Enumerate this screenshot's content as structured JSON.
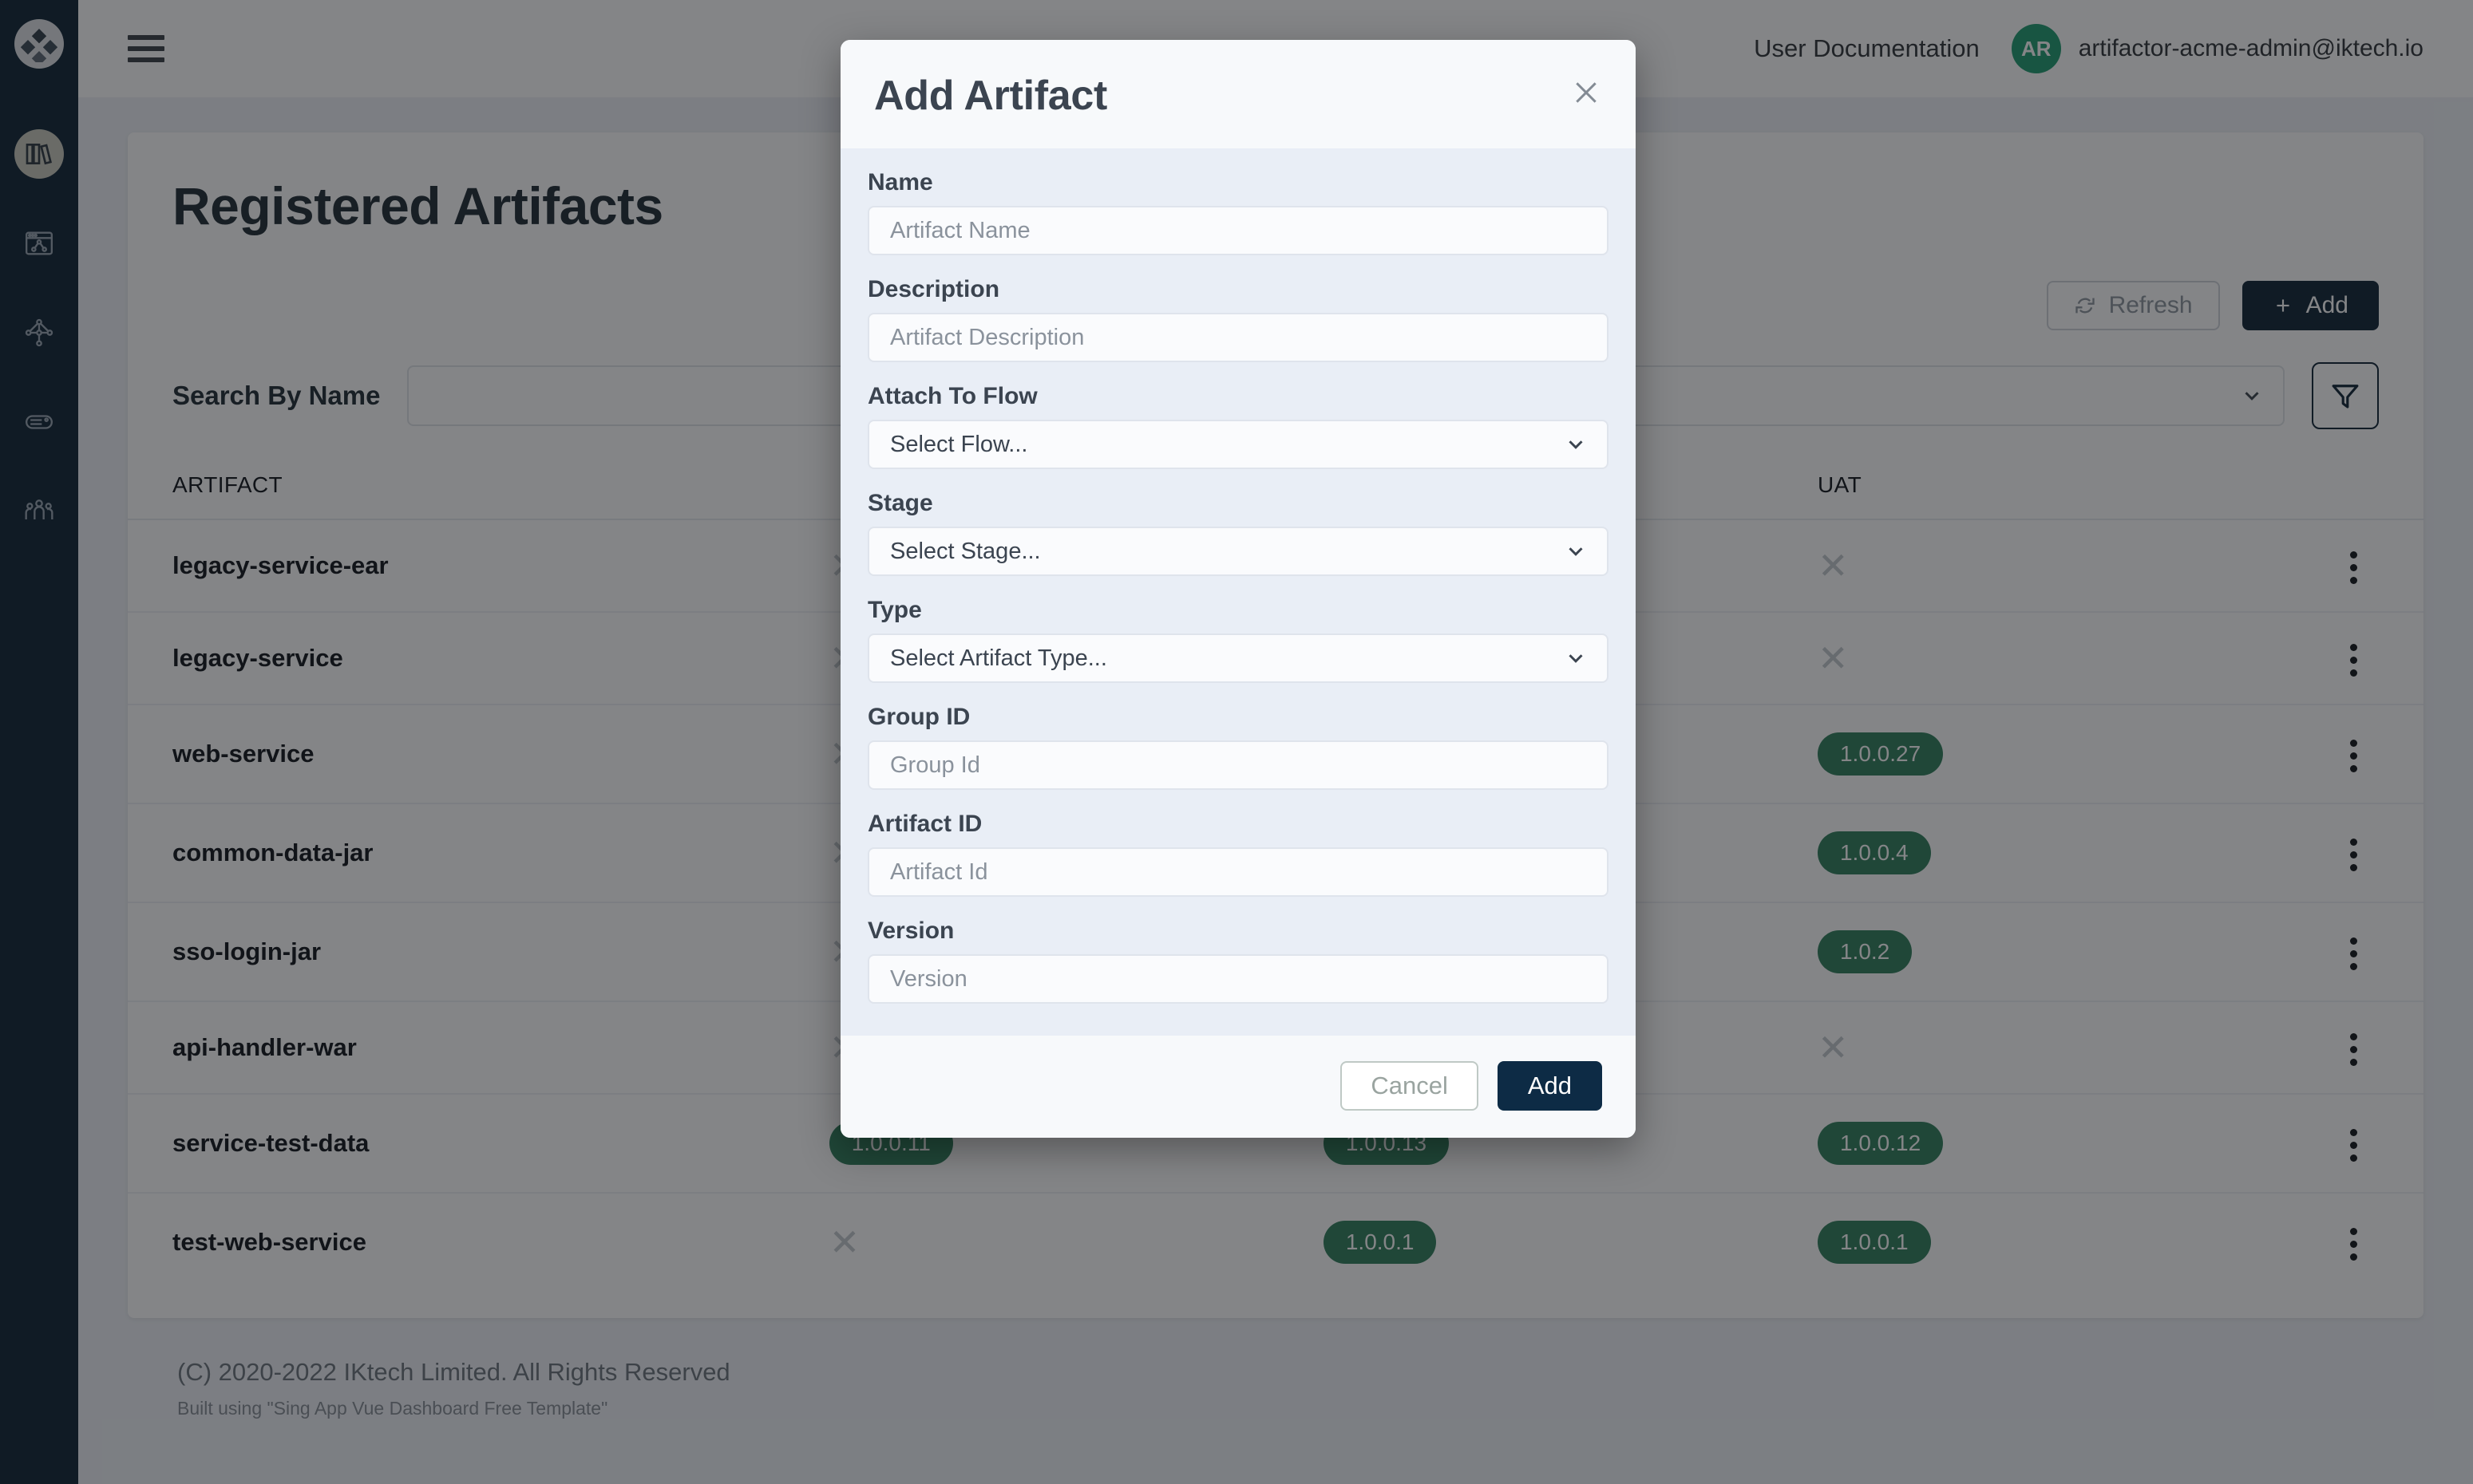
{
  "colors": {
    "sidebar_bg": "#0d2234",
    "accent_dark": "#0d2234",
    "badge_green": "#2e7d5b",
    "avatar_green": "#1f9b6f",
    "modal_body_bg": "#e9eef6",
    "modal_surface": "#f7f9fb"
  },
  "sidebar": {
    "logo_icon": "four-diamonds-logo-icon",
    "items": [
      {
        "icon": "books-icon",
        "name": "artifacts",
        "active": true
      },
      {
        "icon": "browser-flow-icon",
        "name": "flows",
        "active": false
      },
      {
        "icon": "network-topology-icon",
        "name": "topology",
        "active": false
      },
      {
        "icon": "tag-icon",
        "name": "tags",
        "active": false
      },
      {
        "icon": "users-group-icon",
        "name": "users",
        "active": false
      }
    ]
  },
  "topbar": {
    "menu_icon": "hamburger-menu-icon",
    "documentation_link": "User Documentation",
    "avatar_initials": "AR",
    "user_email": "artifactor-acme-admin@iktech.io"
  },
  "page": {
    "title": "Registered Artifacts",
    "refresh_label": "Refresh",
    "refresh_icon": "refresh-icon",
    "add_label": "Add",
    "add_icon": "plus-icon",
    "search_label": "Search By Name",
    "search_value": "",
    "search_placeholder": "",
    "flow_select_value": "",
    "flow_select_chevron": "chevron-down-icon",
    "filter_icon": "funnel-filter-icon"
  },
  "table": {
    "headers": {
      "artifact": "ARTIFACT",
      "dev": "",
      "qa": "",
      "uat": "UAT",
      "actions": ""
    },
    "empty_glyph": "✕",
    "rows": [
      {
        "artifact": "legacy-service-ear",
        "dev": "",
        "qa": "",
        "uat": ""
      },
      {
        "artifact": "legacy-service",
        "dev": "",
        "qa": "",
        "uat": ""
      },
      {
        "artifact": "web-service",
        "dev": "",
        "qa": "",
        "uat": "1.0.0.27"
      },
      {
        "artifact": "common-data-jar",
        "dev": "",
        "qa": "",
        "uat": "1.0.0.4"
      },
      {
        "artifact": "sso-login-jar",
        "dev": "",
        "qa": "",
        "uat": "1.0.2"
      },
      {
        "artifact": "api-handler-war",
        "dev": "",
        "qa": "",
        "uat": ""
      },
      {
        "artifact": "service-test-data",
        "dev": "1.0.0.11",
        "qa": "1.0.0.13",
        "uat": "1.0.0.12"
      },
      {
        "artifact": "test-web-service",
        "dev": "",
        "qa": "1.0.0.1",
        "uat": "1.0.0.1"
      }
    ],
    "row_menu_icon": "kebab-menu-icon"
  },
  "footer": {
    "copyright": "(C) 2020-2022 IKtech Limited. All Rights Reserved",
    "built_with": "Built using \"Sing App Vue Dashboard Free Template\""
  },
  "modal": {
    "title": "Add Artifact",
    "close_icon": "close-icon",
    "fields": [
      {
        "label": "Name",
        "placeholder": "Artifact Name",
        "value": "",
        "type": "text"
      },
      {
        "label": "Description",
        "placeholder": "Artifact Description",
        "value": "",
        "type": "text"
      },
      {
        "label": "Attach To Flow",
        "placeholder": "Select Flow...",
        "value": "Select Flow...",
        "type": "select"
      },
      {
        "label": "Stage",
        "placeholder": "Select Stage...",
        "value": "Select Stage...",
        "type": "select"
      },
      {
        "label": "Type",
        "placeholder": "Select Artifact Type...",
        "value": "Select Artifact Type...",
        "type": "select"
      },
      {
        "label": "Group ID",
        "placeholder": "Group Id",
        "value": "",
        "type": "text"
      },
      {
        "label": "Artifact ID",
        "placeholder": "Artifact Id",
        "value": "",
        "type": "text"
      },
      {
        "label": "Version",
        "placeholder": "Version",
        "value": "",
        "type": "text"
      }
    ],
    "cancel_label": "Cancel",
    "submit_label": "Add"
  }
}
